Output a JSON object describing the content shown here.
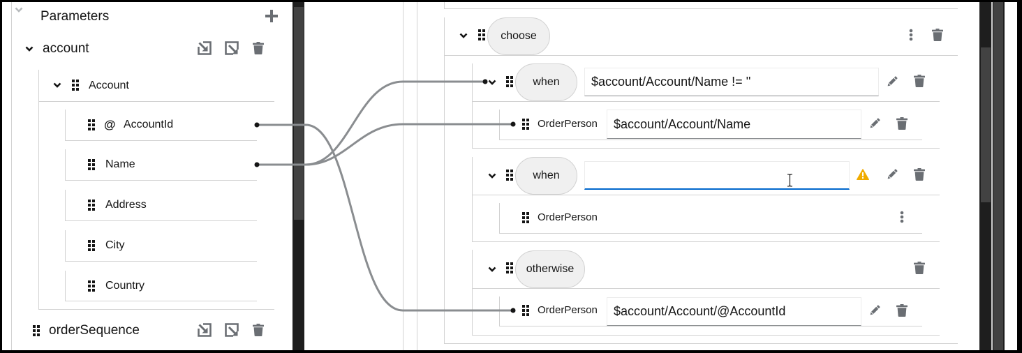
{
  "parameters_panel": {
    "title": "Parameters",
    "params": [
      {
        "name": "account",
        "expanded": true,
        "root_element": {
          "name": "Account",
          "expanded": true,
          "fields": [
            {
              "name": "AccountId",
              "is_attribute": true,
              "attribute_marker": "@"
            },
            {
              "name": "Name"
            },
            {
              "name": "Address"
            },
            {
              "name": "City"
            },
            {
              "name": "Country"
            }
          ]
        }
      },
      {
        "name": "orderSequence",
        "expanded": false
      }
    ]
  },
  "mapping_canvas": {
    "choose": {
      "label": "choose",
      "expanded": true,
      "branches": [
        {
          "type": "when",
          "label": "when",
          "condition": "$account/Account/Name != ''",
          "child": {
            "label": "OrderPerson",
            "value": "$account/Account/Name"
          }
        },
        {
          "type": "when",
          "label": "when",
          "condition": "",
          "focused": true,
          "status": "warning",
          "child": {
            "label": "OrderPerson"
          }
        },
        {
          "type": "otherwise",
          "label": "otherwise",
          "child": {
            "label": "OrderPerson",
            "value": "$account/Account/@AccountId"
          }
        }
      ]
    }
  },
  "icons": {
    "add": "plus-icon",
    "import": "import-icon",
    "export": "export-icon",
    "delete": "trash-icon",
    "edit": "pencil-icon",
    "more": "kebab-icon",
    "drag": "grip-icon",
    "collapse": "chevron-down-icon",
    "warning": "warning-icon"
  },
  "colors": {
    "text": "#151515",
    "icon": "#6a6e73",
    "connector": "#8a8d90",
    "focus_underline": "#0066cc",
    "warning": "#f0ab00",
    "pill_background": "#f0f0f0",
    "divider": "#d2d2d2",
    "scrollbar_track": "#1e1e1e",
    "scrollbar_thumb": "#424242"
  }
}
